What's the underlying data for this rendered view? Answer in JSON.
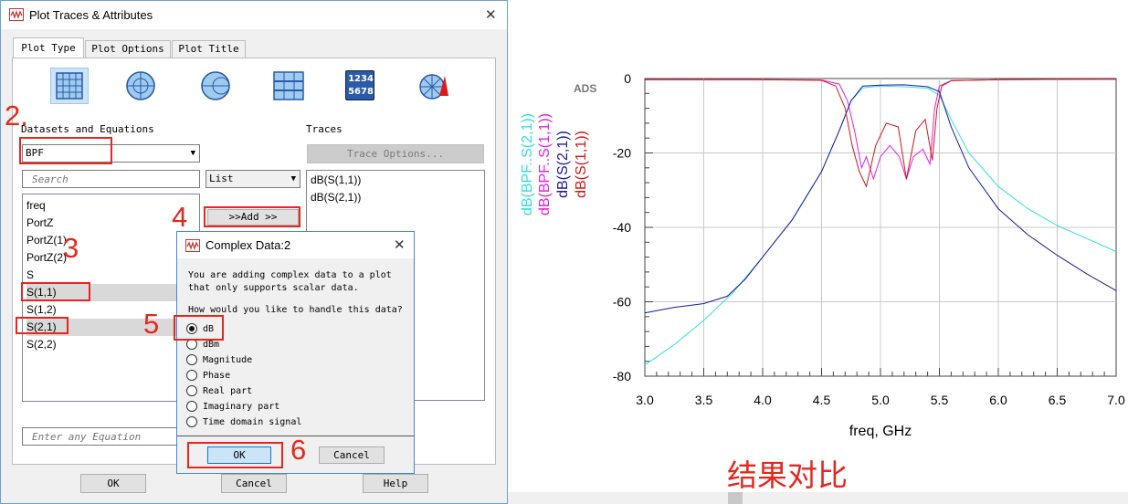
{
  "main_dialog": {
    "title": "Plot Traces & Attributes",
    "close_glyph": "✕",
    "tabs": [
      "Plot Type",
      "Plot Options",
      "Plot Title"
    ],
    "datasets_label": "Datasets and Equations",
    "dataset_selected": "BPF",
    "search_placeholder": "Search",
    "view_mode": "List",
    "variables": [
      "freq",
      "PortZ",
      "PortZ(1)",
      "PortZ(2)",
      "S",
      "S(1,1)",
      "S(1,2)",
      "S(2,1)",
      "S(2,2)"
    ],
    "selected_variables": [
      "S(1,1)",
      "S(2,1)"
    ],
    "traces_label": "Traces",
    "trace_options_button": "Trace Options...",
    "traces": [
      "dB(S(1,1))",
      "dB(S(2,1))"
    ],
    "add_button": ">>Add >>",
    "equation_placeholder": "Enter any Equation",
    "ok_button": "OK",
    "cancel_button": "Cancel",
    "help_button": "Help",
    "plot_type_icons": [
      "rectangular-plot-icon",
      "polar-plot-icon",
      "smith-chart-icon",
      "stacked-plot-icon",
      "list-table-icon",
      "antenna-plot-icon"
    ],
    "list_icon_text": [
      "1234",
      "5678"
    ]
  },
  "complex_dialog": {
    "title": "Complex Data:2",
    "close_glyph": "✕",
    "message_line1": "You are adding complex data to a plot",
    "message_line2": "that only supports scalar data.",
    "question": "How would you like to handle this data?",
    "options": [
      "dB",
      "dBm",
      "Magnitude",
      "Phase",
      "Real part",
      "Imaginary part",
      "Time domain signal"
    ],
    "selected_option": "dB",
    "ok_button": "OK",
    "cancel_button": "Cancel"
  },
  "annotations": {
    "step2": "2.",
    "step3": "3",
    "step4": "4",
    "step5": "5",
    "step6": "6",
    "caption": "结果对比",
    "color": "#e8261e"
  },
  "chart_data": {
    "type": "line",
    "watermark": "ADS",
    "xlabel": "freq, GHz",
    "xlim": [
      3.0,
      7.0
    ],
    "ylim": [
      -80,
      0
    ],
    "x_ticks": [
      "3.0",
      "3.5",
      "4.0",
      "4.5",
      "5.0",
      "5.5",
      "6.0",
      "6.5",
      "7.0"
    ],
    "y_ticks": [
      "0",
      "-20",
      "-40",
      "-60",
      "-80"
    ],
    "grid": true,
    "legend": [
      {
        "label": "dB(BPF..S(2,1))",
        "color": "#33e0e0"
      },
      {
        "label": "dB(BPF..S(1,1))",
        "color": "#e020e0"
      },
      {
        "label": "dB(S(2,1))",
        "color": "#1a1aa0"
      },
      {
        "label": "dB(S(1,1))",
        "color": "#d01818"
      }
    ],
    "legend_placement": "left (vertical)",
    "series": [
      {
        "name": "dB(BPF..S(2,1))",
        "color": "#33e0e0",
        "x": [
          3.0,
          3.25,
          3.5,
          3.75,
          4.0,
          4.25,
          4.5,
          4.65,
          4.75,
          4.85,
          5.0,
          5.2,
          5.4,
          5.5,
          5.6,
          5.75,
          6.0,
          6.25,
          6.5,
          6.75,
          7.0
        ],
        "y": [
          -77,
          -71.5,
          -65,
          -57.5,
          -48,
          -38,
          -25,
          -14,
          -6,
          -2.5,
          -2.0,
          -2.2,
          -2.6,
          -4.5,
          -11,
          -20,
          -29,
          -35,
          -39.5,
          -43,
          -46.5
        ]
      },
      {
        "name": "dB(BPF..S(1,1))",
        "color": "#e020e0",
        "x": [
          3.0,
          4.0,
          4.5,
          4.65,
          4.72,
          4.78,
          4.84,
          4.88,
          4.94,
          5.0,
          5.08,
          5.16,
          5.22,
          5.28,
          5.36,
          5.42,
          5.46,
          5.5,
          5.6,
          6.0,
          7.0
        ],
        "y": [
          -0.3,
          -0.3,
          -0.4,
          -1.5,
          -6,
          -14,
          -24,
          -21,
          -27,
          -21,
          -18,
          -21,
          -27,
          -21,
          -19,
          -23,
          -8,
          -2,
          -0.6,
          -0.3,
          -0.2
        ]
      },
      {
        "name": "dB(S(2,1))",
        "color": "#1a1aa0",
        "x": [
          3.0,
          3.25,
          3.5,
          3.7,
          3.85,
          4.0,
          4.25,
          4.5,
          4.65,
          4.75,
          4.85,
          5.0,
          5.2,
          5.4,
          5.5,
          5.6,
          5.75,
          6.0,
          6.25,
          6.5,
          6.75,
          7.0
        ],
        "y": [
          -63,
          -61.5,
          -60.5,
          -58.5,
          -54,
          -48,
          -38,
          -25,
          -14,
          -6,
          -2.0,
          -1.8,
          -1.7,
          -2.2,
          -3.5,
          -13,
          -24,
          -35,
          -42,
          -47.5,
          -52.5,
          -57
        ]
      },
      {
        "name": "dB(S(1,1))",
        "color": "#d01818",
        "x": [
          3.0,
          4.0,
          4.5,
          4.62,
          4.7,
          4.76,
          4.82,
          4.88,
          4.96,
          5.05,
          5.15,
          5.22,
          5.3,
          5.38,
          5.44,
          5.48,
          5.52,
          5.6,
          6.0,
          7.0
        ],
        "y": [
          -0.3,
          -0.3,
          -0.5,
          -2,
          -8,
          -18,
          -25,
          -29,
          -18,
          -12,
          -13,
          -27,
          -14,
          -11,
          -22,
          -8,
          -2,
          -0.6,
          -0.3,
          -0.2
        ]
      }
    ]
  }
}
